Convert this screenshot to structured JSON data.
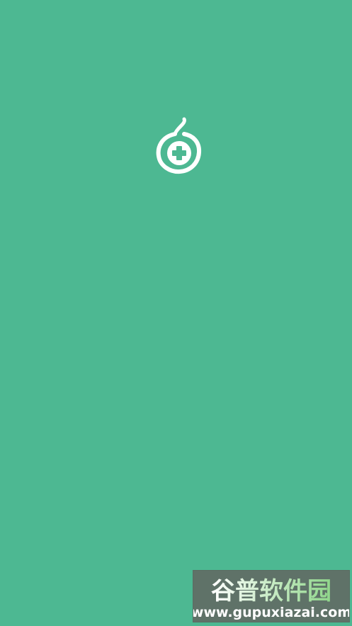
{
  "screen": {
    "background_color": "#4db892"
  },
  "logo": {
    "icon": "medical-cross-gourd-icon",
    "color": "#ffffff"
  },
  "watermark": {
    "title": "谷普软件园",
    "url": "www.gupuxiazai.com",
    "colors": {
      "background": "#5f7268",
      "title_start": "#ffffff",
      "title_end": "#8fd68a",
      "url": "#ffffff"
    }
  }
}
